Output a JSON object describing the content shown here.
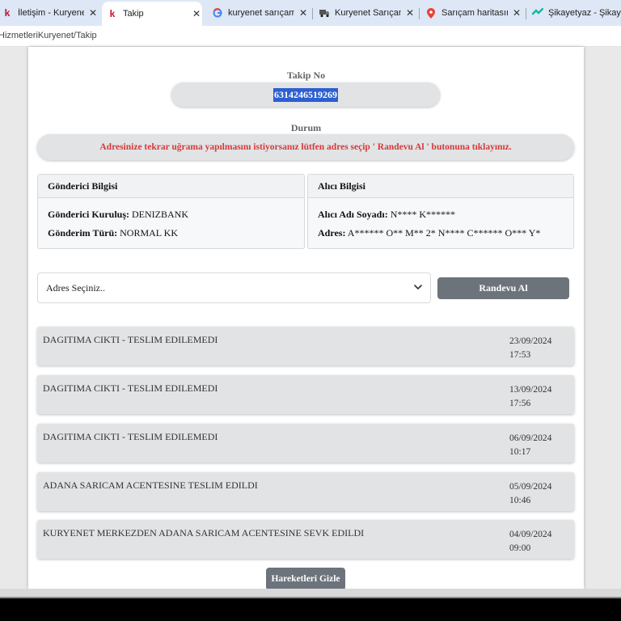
{
  "browser": {
    "tabs": [
      {
        "title": "İletişim - Kuryenet",
        "icon": "kuryenet-k-icon"
      },
      {
        "title": "Takip",
        "icon": "kuryenet-k-icon"
      },
      {
        "title": "kuryenet sarıçam acente",
        "icon": "google-g-icon"
      },
      {
        "title": "Kuryenet Sarıçam Şube",
        "icon": "truck-icon"
      },
      {
        "title": "Sarıçam haritasında Sa",
        "icon": "map-pin-icon"
      },
      {
        "title": "Şikayetyaz - Şikayetvar",
        "icon": "sikayetyaz-icon"
      }
    ],
    "url": "HizmetleriKuryenet/Takip"
  },
  "tracking": {
    "label": "Takip No",
    "number": "6314246519269"
  },
  "status": {
    "label": "Durum",
    "message": "Adresinize tekrar uğrama yapılmasını istiyorsanız lütfen adres seçip ' Randevu Al ' butonuna tıklayınız."
  },
  "sender": {
    "title": "Gönderici Bilgisi",
    "org_label": "Gönderici Kuruluş:",
    "org_value": "DENIZBANK",
    "type_label": "Gönderim Türü:",
    "type_value": "NORMAL KK"
  },
  "recipient": {
    "title": "Alıcı Bilgisi",
    "name_label": "Alıcı Adı Soyadı:",
    "name_value": "N**** K******",
    "address_label": "Adres:",
    "address_value": "A****** O** M** 2* N**** C****** O*** Y*"
  },
  "appointment": {
    "select_placeholder": "Adres Seçiniz..",
    "button_label": "Randevu Al"
  },
  "movements": [
    {
      "description": "DAGITIMA CIKTI - TESLIM EDILEMEDI",
      "date": "23/09/2024",
      "time": "17:53"
    },
    {
      "description": "DAGITIMA CIKTI - TESLIM EDILEMEDI",
      "date": "13/09/2024",
      "time": "17:56"
    },
    {
      "description": "DAGITIMA CIKTI - TESLIM EDILEMEDI",
      "date": "06/09/2024",
      "time": "10:17"
    },
    {
      "description": "ADANA SARICAM ACENTESINE TESLIM EDILDI",
      "date": "05/09/2024",
      "time": "10:46"
    },
    {
      "description": "KURYENET MERKEZDEN ADANA SARICAM ACENTESINE SEVK EDILDI",
      "date": "04/09/2024",
      "time": "09:00"
    }
  ],
  "hide_button_label": "Hareketleri Gizle",
  "colors": {
    "status_text": "#d6393a",
    "button_bg": "#6c737b",
    "selection": "#2d5fcf",
    "kuryenet_brand": "#c8102e"
  }
}
